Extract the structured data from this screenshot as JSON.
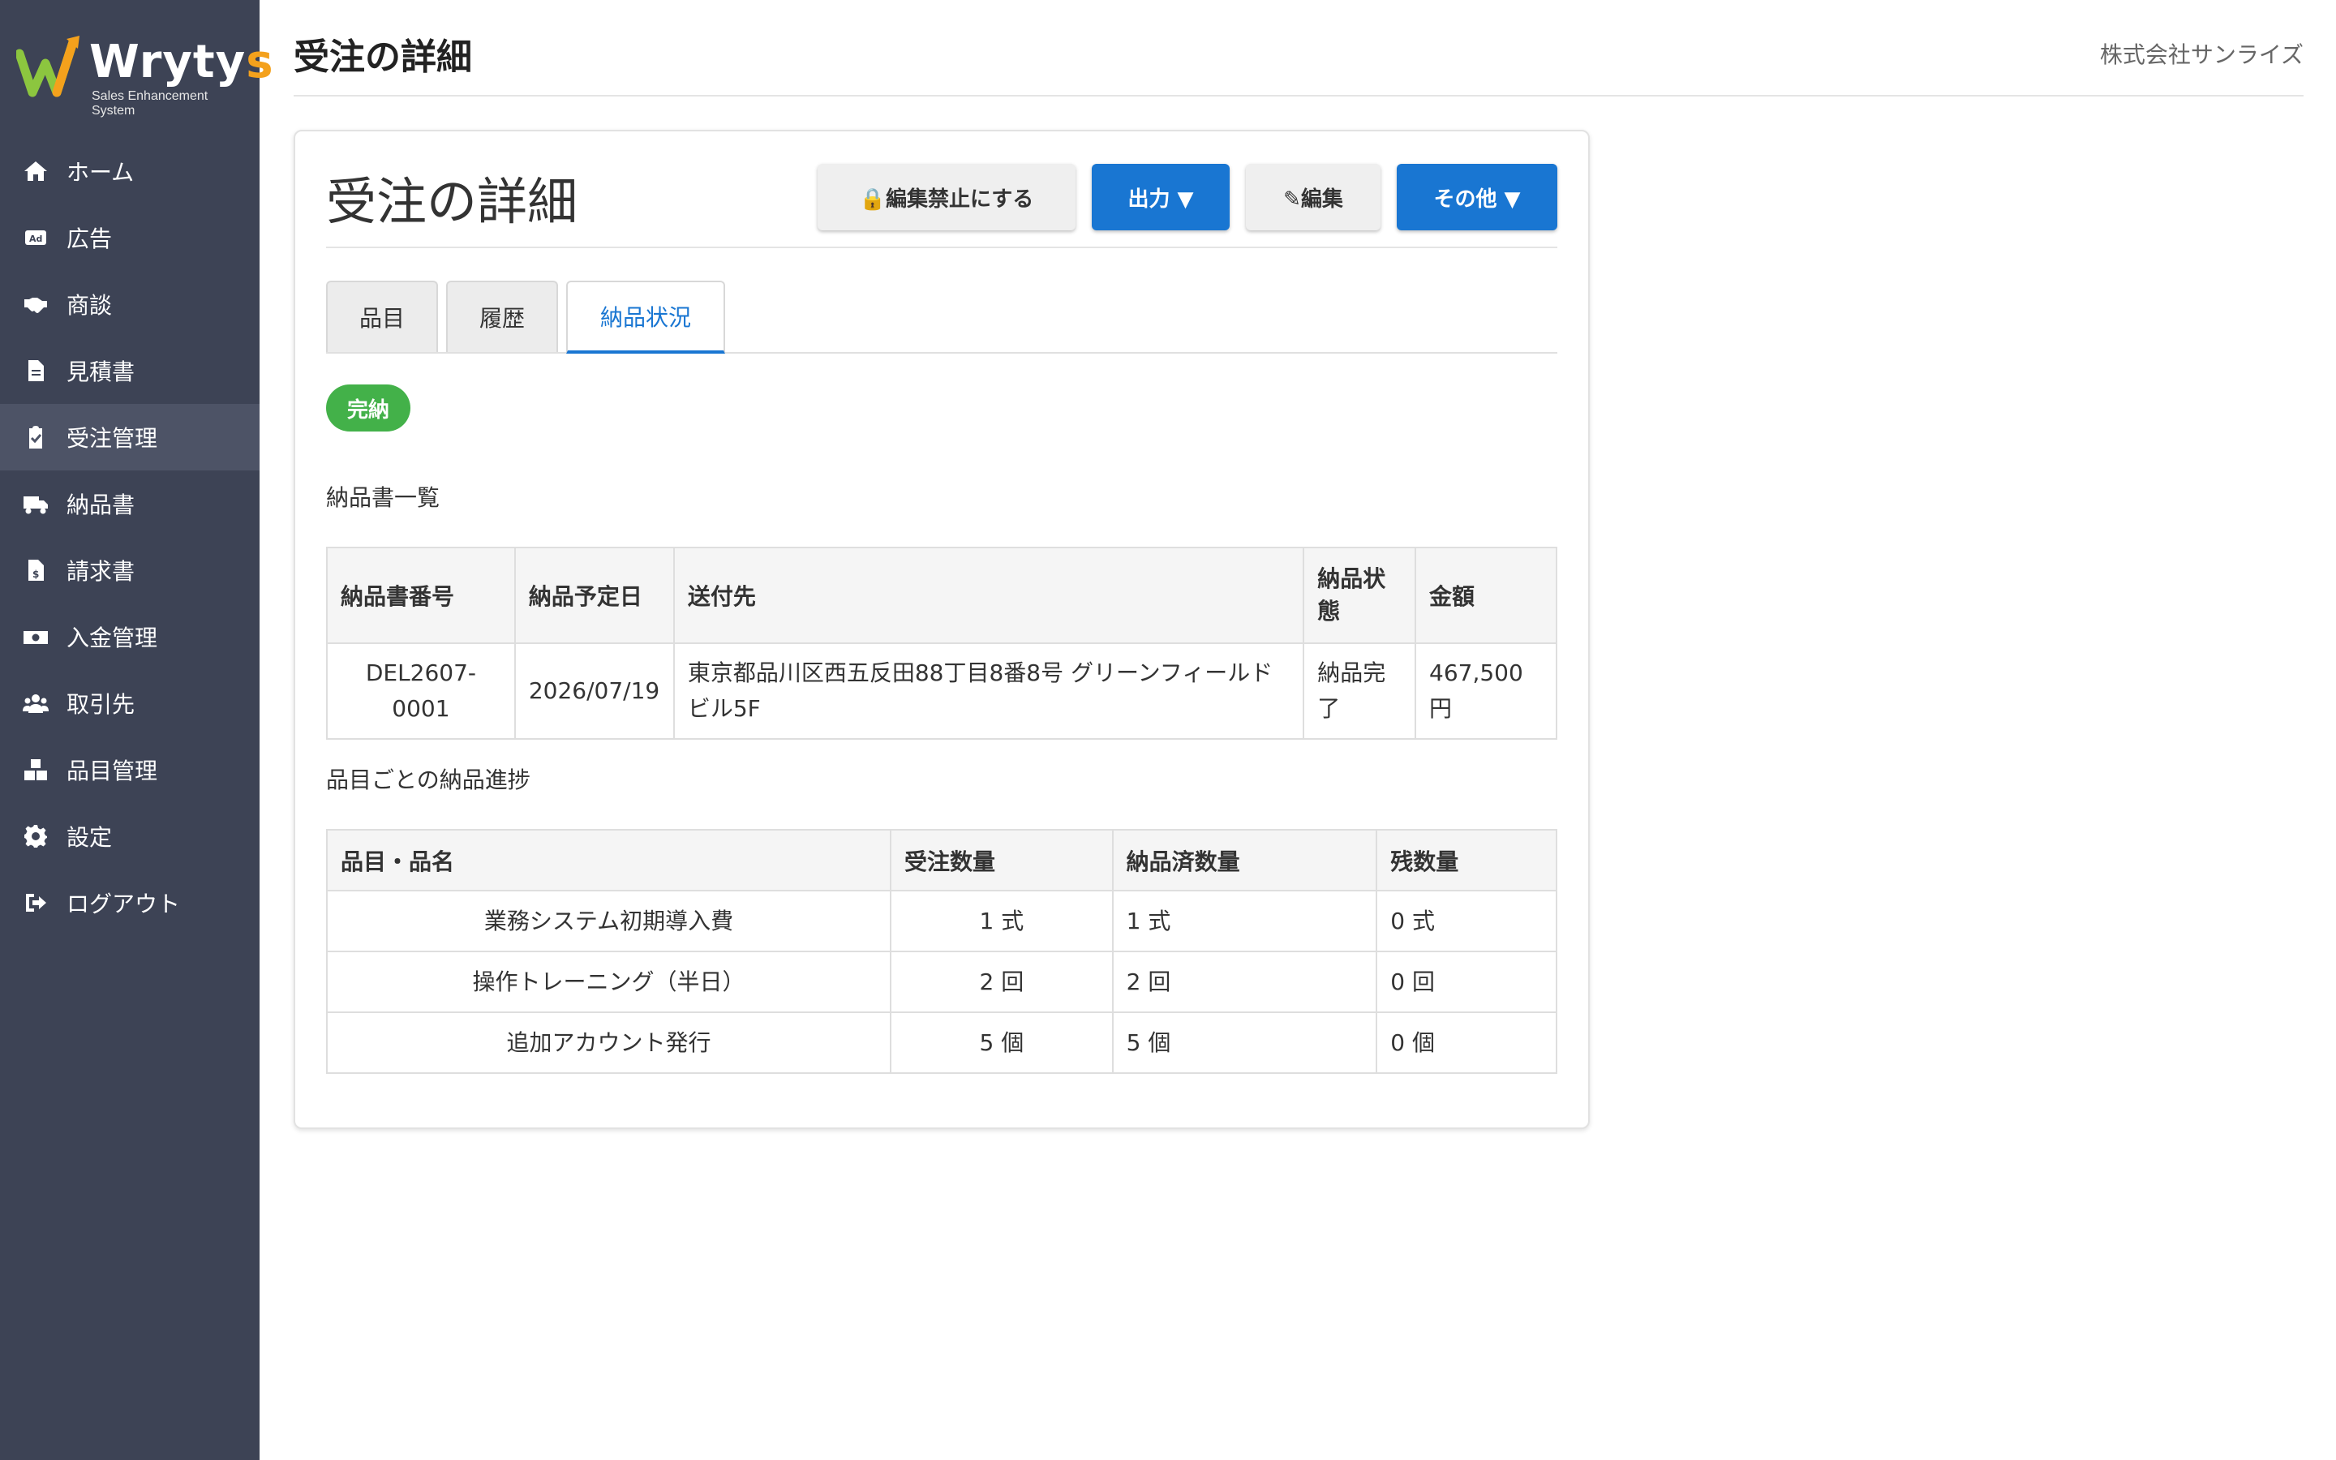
{
  "brand": {
    "name_main": "Wryty",
    "name_accent": "s",
    "tagline": "Sales Enhancement System",
    "colors": {
      "sidebar": "#3d4355",
      "accent": "#f4a11c",
      "primary": "#1976d2",
      "success": "#43b149"
    }
  },
  "sidebar": {
    "items": [
      {
        "label": "ホーム",
        "icon": "home-icon"
      },
      {
        "label": "広告",
        "icon": "ad-icon"
      },
      {
        "label": "商談",
        "icon": "handshake-icon"
      },
      {
        "label": "見積書",
        "icon": "document-icon"
      },
      {
        "label": "受注管理",
        "icon": "clipboard-check-icon"
      },
      {
        "label": "納品書",
        "icon": "truck-icon"
      },
      {
        "label": "請求書",
        "icon": "invoice-icon"
      },
      {
        "label": "入金管理",
        "icon": "money-icon"
      },
      {
        "label": "取引先",
        "icon": "users-icon"
      },
      {
        "label": "品目管理",
        "icon": "boxes-icon"
      },
      {
        "label": "設定",
        "icon": "gear-icon"
      },
      {
        "label": "ログアウト",
        "icon": "logout-icon"
      }
    ],
    "active_index": 4
  },
  "header": {
    "title": "受注の詳細",
    "company": "株式会社サンライズ"
  },
  "card": {
    "title": "受注の詳細",
    "buttons": {
      "lock": "🔒編集禁止にする",
      "export": "出力 ▼",
      "edit": "✎編集",
      "more": "その他 ▼"
    },
    "tabs": [
      {
        "label": "品目"
      },
      {
        "label": "履歴"
      },
      {
        "label": "納品状況"
      }
    ],
    "active_tab": 2,
    "status_badge": "完納",
    "delivery_list_label": "納品書一覧",
    "delivery_table": {
      "headers": [
        "納品書番号",
        "納品予定日",
        "送付先",
        "納品状態",
        "金額"
      ],
      "rows": [
        [
          "DEL2607-0001",
          "2026/07/19",
          "東京都品川区西五反田88丁目8番8号 グリーンフィールドビル5F",
          "納品完了",
          "467,500円"
        ]
      ]
    },
    "progress_label": "品目ごとの納品進捗",
    "progress_table": {
      "headers": [
        "品目・品名",
        "受注数量",
        "納品済数量",
        "残数量"
      ],
      "rows": [
        [
          "業務システム初期導入費",
          "1 式",
          "1 式",
          "0 式"
        ],
        [
          "操作トレーニング（半日）",
          "2 回",
          "2 回",
          "0 回"
        ],
        [
          "追加アカウント発行",
          "5 個",
          "5 個",
          "0 個"
        ]
      ]
    }
  }
}
